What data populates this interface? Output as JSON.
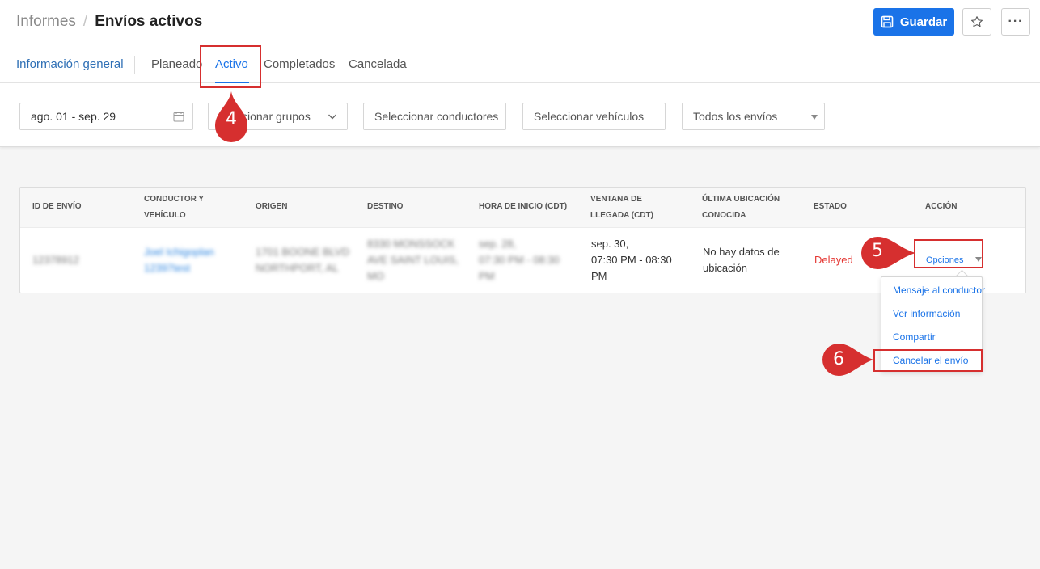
{
  "breadcrumb": {
    "parent": "Informes",
    "separator": "/",
    "current": "Envíos activos"
  },
  "toolbar": {
    "save_label": "Guardar",
    "favorite_icon": "star-icon",
    "more_label": "···"
  },
  "tabs": [
    {
      "label": "Información general"
    },
    {
      "label": "Planeado"
    },
    {
      "label": "Activo",
      "selected": true
    },
    {
      "label": "Completados"
    },
    {
      "label": "Cancelada"
    }
  ],
  "filters": {
    "date_range": "ago. 01 - sep. 29",
    "groups": "cionar grupos",
    "drivers_placeholder": "Seleccionar conductores",
    "vehicles_placeholder": "Seleccionar vehículos",
    "shipments_select": "Todos los envíos"
  },
  "table": {
    "headers": {
      "id": "ID DE ENVÍO",
      "driver_1": "CONDUCTOR Y",
      "driver_2": "VEHÍCULO",
      "origin": "ORIGEN",
      "destination": "DESTINO",
      "start_time": "HORA DE INICIO (CDT)",
      "window_1": "VENTANA DE",
      "window_2": "LLEGADA (CDT)",
      "location_1": "ÚLTIMA UBICACIÓN",
      "location_2": "CONOCIDA",
      "status": "ESTADO",
      "action": "ACCIÓN"
    },
    "row": {
      "id": "12378912",
      "driver": "Joel Ichigoplan",
      "vehicle": "12397test",
      "origin_1": "1701 BOONE BLVD",
      "origin_2": "NORTHPORT, AL",
      "dest_1": "8330 MONSSOCK",
      "dest_2": "AVE SAINT LOUIS,",
      "dest_3": "MO",
      "start_1": "sep. 28,",
      "start_2": "07:30 PM - 08:30",
      "start_3": "PM",
      "window_1": "sep. 30,",
      "window_2": "07:30 PM - 08:30",
      "window_3": "PM",
      "location_1": "No hay datos de",
      "location_2": "ubicación",
      "status": "Delayed",
      "action": "Opciones"
    }
  },
  "options_menu": [
    {
      "label": "Mensaje al conductor"
    },
    {
      "label": "Ver información"
    },
    {
      "label": "Compartir"
    },
    {
      "label": "Cancelar el envío"
    }
  ],
  "annotations": {
    "step_4": "4",
    "step_5": "5",
    "step_6": "6",
    "color": "#d62f2f"
  },
  "colors": {
    "accent": "#1a73e8",
    "status_delayed": "#e53935",
    "annotation": "#d62f2f"
  }
}
